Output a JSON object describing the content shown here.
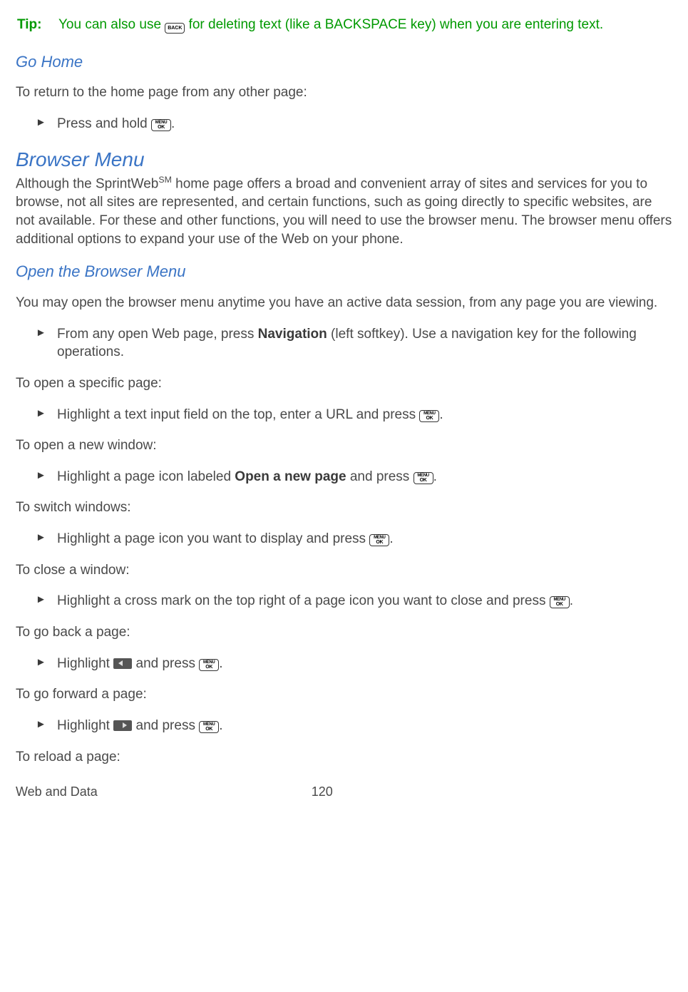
{
  "tip": {
    "label": "Tip:",
    "text_before": "You can also use ",
    "text_after": " for deleting text (like a BACKSPACE key) when you are entering text."
  },
  "go_home": {
    "heading": "Go Home",
    "intro": "To return to the home page from any other page:",
    "step_before": "Press and hold ",
    "step_after": "."
  },
  "browser_menu": {
    "heading": "Browser Menu",
    "para_before_sup": "Although the SprintWeb",
    "sup": "SM",
    "para_after_sup": " home page offers a broad and convenient array of sites and services for you to browse, not all sites are represented, and certain functions, such as going directly to specific websites, are not available. For these and other functions, you will need to use the browser menu. The browser menu offers additional options to expand your use of the Web on your phone."
  },
  "open_menu": {
    "heading": "Open the Browser Menu",
    "intro": "You may open the browser menu anytime you have an active data session, from any page you are viewing.",
    "step_a": "From any open Web page, press ",
    "nav_bold": "Navigation",
    "step_b": " (left softkey).  Use a navigation key for the following operations."
  },
  "specific": {
    "intro": "To open a specific page:",
    "step_before": "Highlight a text input field on the top, enter a URL and press ",
    "step_after": "."
  },
  "new_window": {
    "intro": "To open a new window:",
    "step_a": "Highlight a page icon labeled ",
    "bold": "Open a new page",
    "step_b": " and press ",
    "step_c": "."
  },
  "switch": {
    "intro": "To switch windows:",
    "step_before": "Highlight a page icon you want to display and press ",
    "step_after": "."
  },
  "close": {
    "intro": "To close a window:",
    "step_before": "Highlight a cross mark on the top right of a page icon you want to close and press ",
    "step_after": "."
  },
  "back": {
    "intro": "To go back a page:",
    "step_a": "Highlight ",
    "step_b": " and press ",
    "step_c": "."
  },
  "forward": {
    "intro": "To go forward a page:",
    "step_a": "Highlight ",
    "step_b": " and press ",
    "step_c": "."
  },
  "reload": {
    "intro": "To reload a page:"
  },
  "footer": {
    "section": "Web and Data",
    "page": "120"
  },
  "keys": {
    "back": "BACK",
    "ok_top": "MENU",
    "ok_bot": "OK"
  }
}
